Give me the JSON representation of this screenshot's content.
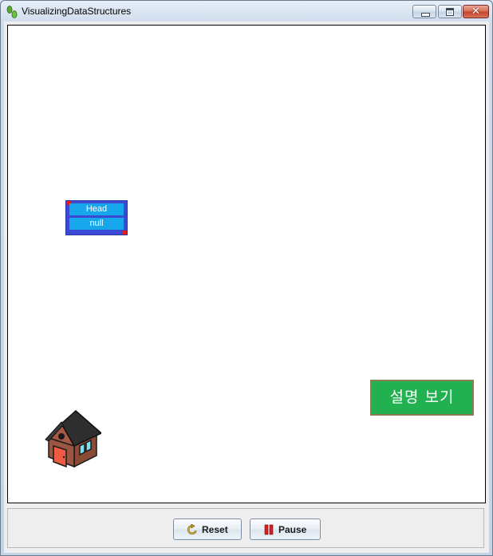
{
  "window": {
    "title": "VisualizingDataStructures",
    "controls": [
      "minimize",
      "maximize",
      "close"
    ],
    "close_glyph": "✕"
  },
  "canvas": {
    "head_node": {
      "label": "Head",
      "value": "null"
    },
    "house_icon": "house-icon",
    "explain_button": {
      "label": "설명 보기",
      "color": "#21b150"
    }
  },
  "controls": {
    "reset": {
      "label": "Reset",
      "icon": "reset-icon"
    },
    "pause": {
      "label": "Pause",
      "icon": "pause-icon"
    }
  },
  "colors": {
    "node_border": "#3b49d4",
    "node_field": "#16a6ec",
    "node_corner": "#e21b1b"
  }
}
